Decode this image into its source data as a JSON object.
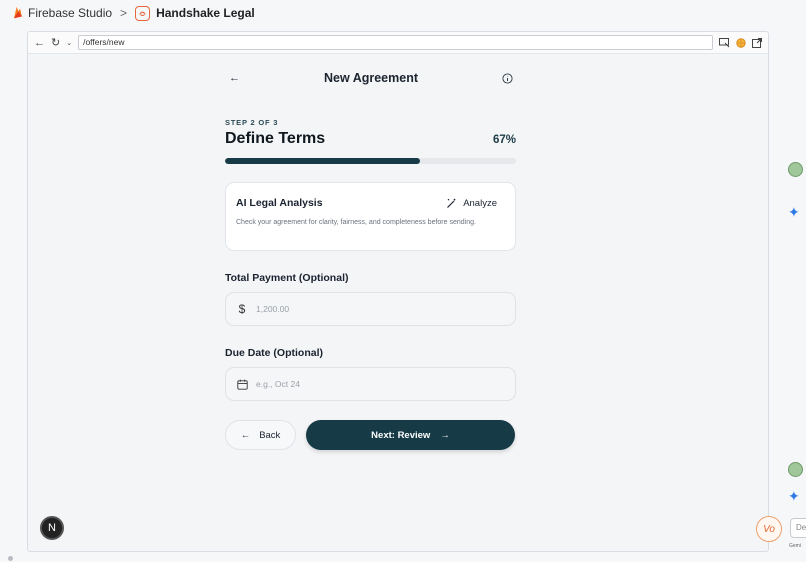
{
  "studio": {
    "product": "Firebase Studio",
    "separator": ">",
    "project": "Handshake Legal"
  },
  "browser": {
    "url": "/offers/new"
  },
  "page": {
    "title": "New Agreement",
    "step_label": "STEP 2 OF 3",
    "step_title": "Define Terms",
    "progress_text": "67%",
    "progress_fraction": 0.67
  },
  "ai_card": {
    "title": "AI Legal Analysis",
    "button": "Analyze",
    "description": "Check your agreement for clarity, fairness, and completeness before sending."
  },
  "payment": {
    "label": "Total Payment (Optional)",
    "currency_symbol": "$",
    "placeholder": "1,200.00"
  },
  "due_date": {
    "label": "Due Date (Optional)",
    "placeholder": "e.g., Oct 24"
  },
  "actions": {
    "back": "Back",
    "next": "Next: Review"
  },
  "badges": {
    "next_dev": "N",
    "vo": "Vo"
  },
  "rail": {
    "input_value": "De",
    "caption": "Gemi"
  },
  "colors": {
    "primary": "#163a46",
    "accent_star": "#2f7be6",
    "flame": "#f57c1f"
  }
}
